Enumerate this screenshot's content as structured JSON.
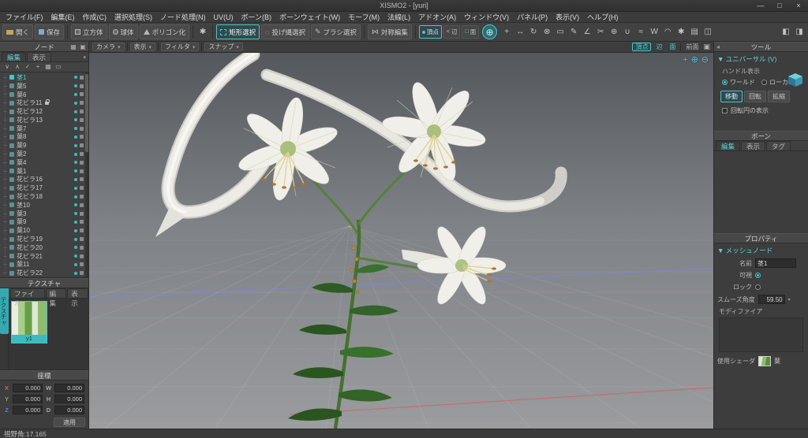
{
  "titlebar": {
    "title": "XISMO2 - [yuri]",
    "minimize": "—",
    "maximize": "□",
    "close": "×"
  },
  "menubar": {
    "items": [
      "ファイル(F)",
      "編集(E)",
      "作成(C)",
      "選択処理(S)",
      "ノード処理(N)",
      "UV(U)",
      "ボーン(B)",
      "ボーンウェイト(W)",
      "モーフ(M)",
      "法線(L)",
      "アドオン(A)",
      "ウィンドウ(V)",
      "パネル(P)",
      "表示(V)",
      "ヘルプ(H)"
    ]
  },
  "toolbar": {
    "open": "開く",
    "save": "保存",
    "cube": "立方体",
    "sphere": "球体",
    "polygonize": "ポリゴン化",
    "settings_icon": "✱",
    "rect_select": "矩形選択",
    "lasso_select": "投げ縄選択",
    "brush_select": "ブラシ選択",
    "symmetry": "対称編集",
    "vertex": "頂点",
    "edge": "辺",
    "face": "面",
    "globe_icon": "⊕",
    "icons": [
      "+",
      "↔",
      "↻",
      "⊗",
      "▭",
      "✎",
      "∠",
      "✂",
      "⊕",
      "∪",
      "≈",
      "W",
      "◠",
      "✱",
      "▤",
      "◫"
    ],
    "panel_icons": [
      "◧",
      "◨"
    ]
  },
  "viewbar": {
    "camera": "カメラ",
    "display": "表示",
    "filter": "フィルタ",
    "snap": "スナップ",
    "chevron": "▾",
    "vertex": "頂点",
    "edge": "辺",
    "face": "面",
    "front": "前面",
    "maximize_icon": "▣"
  },
  "viewport": {
    "pan_icon": "+",
    "zoom_in_icon": "⊕",
    "zoom_out_icon": "⊖"
  },
  "node_panel": {
    "title": "ノード",
    "header_icons": [
      "▦",
      "▣"
    ],
    "tabs": [
      "編集",
      "表示"
    ],
    "tool_icons": [
      "∨",
      "∧",
      "✓",
      "+",
      "▦",
      "▭"
    ],
    "items": [
      {
        "name": "茎1",
        "selected": true
      },
      {
        "name": "葉5"
      },
      {
        "name": "葉6"
      },
      {
        "name": "花ビラ11",
        "locked": true
      },
      {
        "name": "花ビラ12"
      },
      {
        "name": "花ビラ13"
      },
      {
        "name": "葉7"
      },
      {
        "name": "葉8"
      },
      {
        "name": "葉9"
      },
      {
        "name": "葉2"
      },
      {
        "name": "葉4"
      },
      {
        "name": "葉1"
      },
      {
        "name": "花ビラ16"
      },
      {
        "name": "花ビラ17"
      },
      {
        "name": "花ビラ18"
      },
      {
        "name": "茎10"
      },
      {
        "name": "葉3"
      },
      {
        "name": "葉9"
      },
      {
        "name": "葉10"
      },
      {
        "name": "花ビラ19"
      },
      {
        "name": "花ビラ20"
      },
      {
        "name": "花ビラ21"
      },
      {
        "name": "葉11"
      },
      {
        "name": "花ビラ22"
      }
    ]
  },
  "texture_panel": {
    "title": "テクスチャ",
    "side_tab": "テクスチャ",
    "tabs": [
      "ファイル",
      "編集",
      "表示"
    ],
    "thumb_label": "y1"
  },
  "coord_panel": {
    "title": "座標",
    "apply": "適用",
    "rows": [
      {
        "axis": "X",
        "value": "0.000"
      },
      {
        "axis": "Y",
        "value": "0.000"
      },
      {
        "axis": "Z",
        "value": "0.000"
      },
      {
        "axis": "W",
        "value": "0.000"
      },
      {
        "axis": "H",
        "value": "0.000"
      },
      {
        "axis": "D",
        "value": "0.000"
      }
    ]
  },
  "tool_panel": {
    "title": "ツール",
    "section": "▼ ユニバーサル (V)",
    "handle_label": "ハンドル表示",
    "world": "ワールド",
    "local": "ローカル",
    "move": "移動",
    "rotate": "回転",
    "scale": "拡縮",
    "circle_label": "回転円の表示"
  },
  "bone_panel": {
    "title": "ボーン",
    "tabs": [
      "編集",
      "表示",
      "タグ"
    ]
  },
  "property_panel": {
    "title": "プロパティ",
    "section": "▼ メッシュノード",
    "name_label": "名前",
    "name_value": "茎1",
    "visible_label": "可視",
    "lock_label": "ロック",
    "smooth_label": "スムーズ角度",
    "smooth_value": "59.50",
    "modifier_label": "モディファイア",
    "shader_label": "使用シェーダ",
    "shader_value": "葉"
  },
  "statusbar": {
    "fov": "視野角:17.165"
  },
  "colors": {
    "accent": "#4cc4cc",
    "panel_bg": "#3d3d3d",
    "toolbar_bg": "#414141",
    "viewport_top": "#54575c",
    "viewport_bottom": "#9a9c9f",
    "axis_x": "#c96a6a",
    "axis_z": "#7b87d6",
    "stem": "#45722f",
    "petal": "#f0efe9"
  }
}
